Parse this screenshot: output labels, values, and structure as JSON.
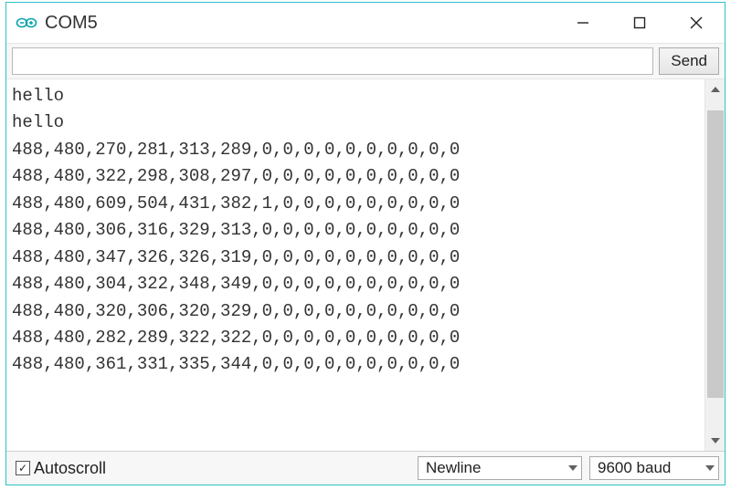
{
  "titlebar": {
    "title": "COM5"
  },
  "toolbar": {
    "input_value": "",
    "input_placeholder": "",
    "send_label": "Send"
  },
  "output_lines": [
    "hello",
    "hello",
    "488,480,270,281,313,289,0,0,0,0,0,0,0,0,0,0",
    "488,480,322,298,308,297,0,0,0,0,0,0,0,0,0,0",
    "488,480,609,504,431,382,1,0,0,0,0,0,0,0,0,0",
    "488,480,306,316,329,313,0,0,0,0,0,0,0,0,0,0",
    "488,480,347,326,326,319,0,0,0,0,0,0,0,0,0,0",
    "488,480,304,322,348,349,0,0,0,0,0,0,0,0,0,0",
    "488,480,320,306,320,329,0,0,0,0,0,0,0,0,0,0",
    "488,480,282,289,322,322,0,0,0,0,0,0,0,0,0,0",
    "488,480,361,331,335,344,0,0,0,0,0,0,0,0,0,0"
  ],
  "footer": {
    "autoscroll_label": "Autoscroll",
    "autoscroll_checked": true,
    "line_ending": "Newline",
    "baud": "9600 baud"
  }
}
